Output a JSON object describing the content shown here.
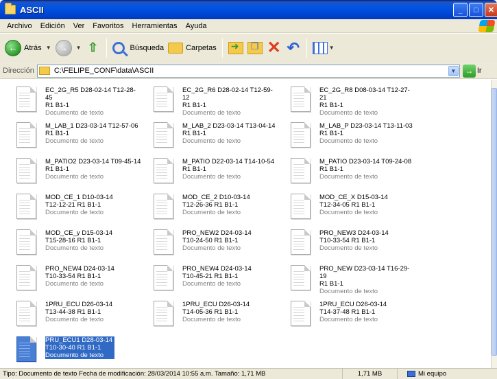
{
  "window": {
    "title": "ASCII"
  },
  "menu": [
    "Archivo",
    "Edición",
    "Ver",
    "Favoritos",
    "Herramientas",
    "Ayuda"
  ],
  "toolbar": {
    "back_label": "Atrás",
    "search_label": "Búsqueda",
    "folders_label": "Carpetas"
  },
  "address": {
    "label": "Dirección",
    "path": "C:\\FELIPE_CONF\\data\\ASCII",
    "go_label": "Ir"
  },
  "files": [
    {
      "line1": "EC_2G_R5 D28-02-14 T12-28-45",
      "line2": "R1 B1-1",
      "type": "Documento de texto"
    },
    {
      "line1": "EC_2G_R6 D28-02-14 T12-59-12",
      "line2": "R1 B1-1",
      "type": "Documento de texto"
    },
    {
      "line1": "EC_2G_R8 D08-03-14 T12-27-21",
      "line2": "R1 B1-1",
      "type": "Documento de texto"
    },
    {
      "line1": "M_LAB_1 D23-03-14 T12-57-06",
      "line2": "R1 B1-1",
      "type": "Documento de texto"
    },
    {
      "line1": "M_LAB_2 D23-03-14 T13-04-14",
      "line2": "R1 B1-1",
      "type": "Documento de texto"
    },
    {
      "line1": "M_LAB_P D23-03-14 T13-11-03",
      "line2": "R1 B1-1",
      "type": "Documento de texto"
    },
    {
      "line1": "M_PATIO2 D23-03-14 T09-45-14",
      "line2": "R1 B1-1",
      "type": "Documento de texto"
    },
    {
      "line1": "M_PATIO D22-03-14 T14-10-54",
      "line2": "R1 B1-1",
      "type": "Documento de texto"
    },
    {
      "line1": "M_PATIO D23-03-14 T09-24-08",
      "line2": "R1 B1-1",
      "type": "Documento de texto"
    },
    {
      "line1": "MOD_CE_1 D10-03-14",
      "line2": "T12-12-21 R1 B1-1",
      "type": "Documento de texto"
    },
    {
      "line1": "MOD_CE_2 D10-03-14",
      "line2": "T12-26-36 R1 B1-1",
      "type": "Documento de texto"
    },
    {
      "line1": "MOD_CE_X D15-03-14",
      "line2": "T12-34-05 R1 B1-1",
      "type": "Documento de texto"
    },
    {
      "line1": "MOD_CE_y D15-03-14",
      "line2": "T15-28-16 R1 B1-1",
      "type": "Documento de texto"
    },
    {
      "line1": "PRO_NEW2 D24-03-14",
      "line2": "T10-24-50 R1 B1-1",
      "type": "Documento de texto"
    },
    {
      "line1": "PRO_NEW3 D24-03-14",
      "line2": "T10-33-54 R1 B1-1",
      "type": "Documento de texto"
    },
    {
      "line1": "PRO_NEW4 D24-03-14",
      "line2": "T10-33-54 R1 B1-1",
      "type": "Documento de texto"
    },
    {
      "line1": "PRO_NEW4 D24-03-14",
      "line2": "T10-45-21 R1 B1-1",
      "type": "Documento de texto"
    },
    {
      "line1": "PRO_NEW D23-03-14 T16-29-19",
      "line2": "R1 B1-1",
      "type": "Documento de texto"
    },
    {
      "line1": "1PRU_ECU D26-03-14",
      "line2": "T13-44-38 R1 B1-1",
      "type": "Documento de texto"
    },
    {
      "line1": "1PRU_ECU D26-03-14",
      "line2": "T14-05-36 R1 B1-1",
      "type": "Documento de texto"
    },
    {
      "line1": "1PRU_ECU D26-03-14",
      "line2": "T14-37-48 R1 B1-1",
      "type": "Documento de texto"
    },
    {
      "line1": "PRU_ECU1 D28-03-14",
      "line2": "T10-30-40 R1 B1-1",
      "type": "Documento de texto",
      "selected": true
    }
  ],
  "status": {
    "main": "Tipo: Documento de texto Fecha de modificación: 28/03/2014 10:55 a.m. Tamaño: 1,71 MB",
    "size": "1,71 MB",
    "computer": "Mi equipo"
  }
}
